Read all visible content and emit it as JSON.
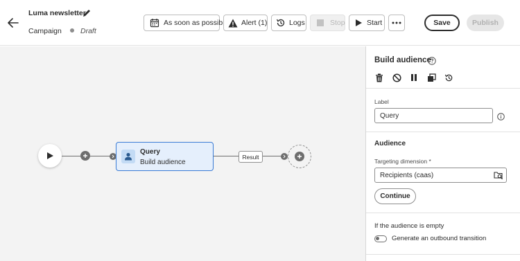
{
  "header": {
    "title": "Luma newsletter",
    "breadcrumb": "Campaign",
    "status": "Draft",
    "toolbar": {
      "schedule_label": "As soon as possible",
      "alert_label": "Alert (1)",
      "logs_label": "Logs",
      "stop_label": "Stop",
      "start_label": "Start",
      "save_label": "Save",
      "publish_label": "Publish"
    }
  },
  "canvas": {
    "query_node": {
      "title": "Query",
      "subtitle": "Build audience"
    },
    "transition_label": "Result"
  },
  "panel": {
    "title": "Build audience",
    "label_field": {
      "label": "Label",
      "value": "Query"
    },
    "audience_section": {
      "title": "Audience",
      "targeting_label": "Targeting dimension",
      "required_mark": "*",
      "targeting_value": "Recipients (caas)",
      "continue_label": "Continue"
    },
    "empty_section": {
      "label": "If the audience is empty",
      "toggle_label": "Generate an outbound transition",
      "toggle_on": false
    }
  },
  "colors": {
    "accent": "#3a7bd5",
    "node_fill": "#e5effc",
    "canvas_bg": "#f3f3f3"
  }
}
